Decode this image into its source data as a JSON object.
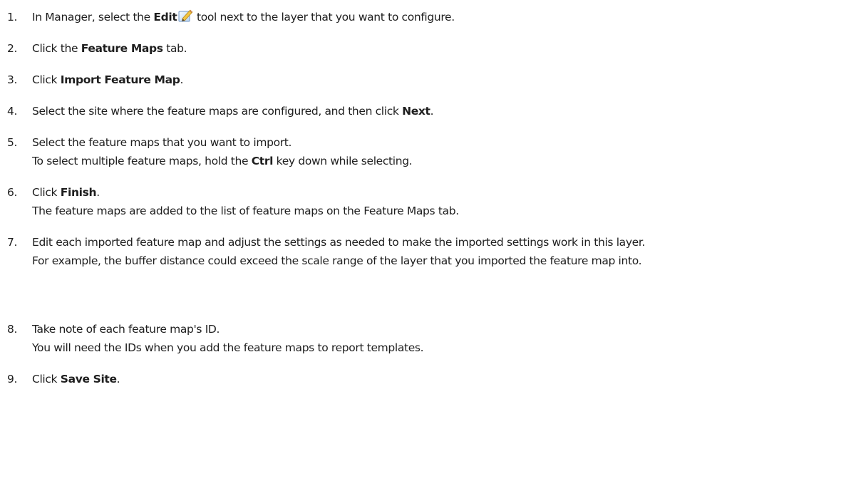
{
  "steps": [
    {
      "number": "1.",
      "parts": [
        "In Manager, select the ",
        "Edit",
        " tool next to the layer that you want to configure."
      ],
      "icon": "pencil-edit-icon"
    },
    {
      "number": "2.",
      "parts": [
        "Click the ",
        "Feature Maps",
        " tab."
      ]
    },
    {
      "number": "3.",
      "parts": [
        "Click ",
        "Import Feature Map",
        "."
      ]
    },
    {
      "number": "4.",
      "parts": [
        "Select the site where the feature maps are configured, and then click ",
        "Next",
        "."
      ]
    },
    {
      "number": "5.",
      "parts": [
        "Select the feature maps that you want to import."
      ],
      "note": [
        "To select multiple feature maps, hold the ",
        "Ctrl",
        " key down while selecting."
      ]
    },
    {
      "number": "6.",
      "parts": [
        "Click ",
        "Finish",
        "."
      ],
      "note": [
        "The feature maps are added to the list of feature maps on the Feature Maps tab."
      ]
    },
    {
      "number": "7.",
      "parts": [
        "Edit each imported feature map and adjust the settings as needed to make the imported settings work in this layer."
      ],
      "note": [
        "For example, the buffer distance could exceed the scale range of the layer that you imported the feature map into."
      ]
    },
    {
      "number": "8.",
      "parts": [
        "Take note of each feature map's ID."
      ],
      "note": [
        "You will need the IDs when you add the feature maps to report templates."
      ]
    },
    {
      "number": "9.",
      "parts": [
        "Click ",
        "Save Site",
        "."
      ]
    }
  ]
}
